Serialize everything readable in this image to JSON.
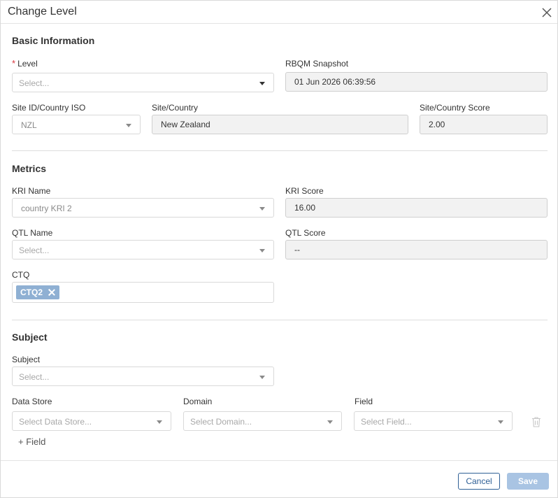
{
  "dialog": {
    "title": "Change Level"
  },
  "basic": {
    "title": "Basic Information",
    "level": {
      "label": "Level",
      "required": "*",
      "placeholder": "Select..."
    },
    "snapshot": {
      "label": "RBQM Snapshot",
      "value": "01 Jun 2026 06:39:56"
    },
    "site_id": {
      "label": "Site ID/Country ISO",
      "value": "NZL"
    },
    "site_country": {
      "label": "Site/Country",
      "value": "New Zealand"
    },
    "site_score": {
      "label": "Site/Country Score",
      "value": "2.00"
    }
  },
  "metrics": {
    "title": "Metrics",
    "kri_name": {
      "label": "KRI Name",
      "value": "country KRI 2"
    },
    "kri_score": {
      "label": "KRI Score",
      "value": "16.00"
    },
    "qtl_name": {
      "label": "QTL Name",
      "placeholder": "Select..."
    },
    "qtl_score": {
      "label": "QTL Score",
      "value": "--"
    },
    "ctq": {
      "label": "CTQ",
      "tags": [
        "CTQ2"
      ]
    }
  },
  "subject": {
    "title": "Subject",
    "subject": {
      "label": "Subject",
      "placeholder": "Select..."
    },
    "data_store": {
      "label": "Data Store",
      "placeholder": "Select Data Store..."
    },
    "domain": {
      "label": "Domain",
      "placeholder": "Select Domain..."
    },
    "field": {
      "label": "Field",
      "placeholder": "Select Field..."
    },
    "add_field": "+ Field"
  },
  "footer": {
    "cancel": "Cancel",
    "save": "Save"
  },
  "icons": {
    "close": "close-icon",
    "trash": "trash-icon",
    "caret": "chevron-down-icon",
    "tag_remove": "close-icon"
  },
  "colors": {
    "tag_bg": "#8fb0d3",
    "primary": "#2f6096",
    "save_disabled": "#a9c4e3",
    "required": "#d9363e"
  }
}
